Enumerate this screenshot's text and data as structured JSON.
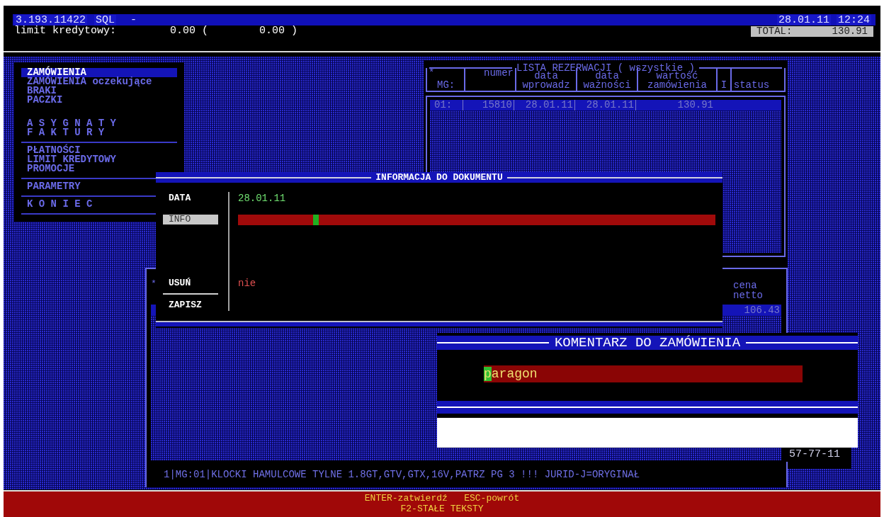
{
  "title_bar": {
    "version": "3.193.11422",
    "mode": "SQL",
    "separator": "-",
    "date": "28.01.11",
    "time": "12:24"
  },
  "credit": {
    "label": "limit kredytowy:",
    "value": "0.00 (",
    "value_2": "0.00 )"
  },
  "total": {
    "label": "TOTAL:",
    "value": "130.91"
  },
  "menu": {
    "groups": [
      {
        "divider": false,
        "items": [
          {
            "label": "ZAMÓWIENIA",
            "selected": true
          },
          {
            "label": "ZAMÓWIENIA oczekujące",
            "selected": false
          },
          {
            "label": "BRAKI",
            "selected": false
          },
          {
            "label": "PACZKI",
            "selected": false
          }
        ]
      },
      {
        "divider": true,
        "items": [
          {
            "label": "A S Y G N A T Y",
            "selected": false
          },
          {
            "label": "F A K T U R Y",
            "selected": false
          }
        ]
      },
      {
        "divider": true,
        "items": [
          {
            "label": "PŁATNOŚCI",
            "selected": false
          },
          {
            "label": "LIMIT KREDYTOWY",
            "selected": false
          },
          {
            "label": "PROMOCJE",
            "selected": false
          }
        ]
      },
      {
        "divider": true,
        "items": [
          {
            "label": "PARAMETRY",
            "selected": false
          }
        ]
      },
      {
        "divider": true,
        "items": [
          {
            "label": "K O N I E C",
            "selected": false
          }
        ]
      }
    ]
  },
  "reservations": {
    "title": "LISTA REZERWACJI ( wszystkie )",
    "columns": [
      {
        "heading": [
          "*",
          "MG:"
        ]
      },
      {
        "heading": [
          "numer"
        ]
      },
      {
        "heading": [
          "data",
          "wprowadz"
        ]
      },
      {
        "heading": [
          "data",
          "ważności"
        ]
      },
      {
        "heading": [
          "wartość",
          "zamówienia"
        ]
      },
      {
        "heading": [
          "I"
        ]
      },
      {
        "heading": [
          "status"
        ]
      }
    ],
    "rows": [
      {
        "cells": [
          "01:",
          "15810",
          "28.01.11",
          "28.01.11",
          "130.91"
        ],
        "selected": true
      }
    ]
  },
  "items_panel": {
    "marker": "*",
    "price_heading": [
      "cena",
      "netto"
    ],
    "rows": [
      {
        "price": "106.43",
        "selected": true
      }
    ],
    "code": "57-77-11",
    "description": "1|MG:01|KLOCKI HAMULCOWE TYLNE 1.8GT,GTV,GTX,16V,PATRZ PG 3 !!! JURID-J=ORYGINAŁ"
  },
  "info_dialog": {
    "title": "INFORMACJA DO DOKUMENTU",
    "fields": [
      {
        "label": "DATA",
        "kind": "date",
        "value": "28.01.11",
        "selected": false
      },
      {
        "label": "INFO",
        "kind": "input",
        "selected": true
      },
      {
        "label": "USUŃ",
        "kind": "flag",
        "value": "nie",
        "selected": false
      }
    ],
    "action": "ZAPISZ"
  },
  "comment_dialog": {
    "title": "KOMENTARZ DO ZAMÓWIENIA",
    "value": "paragon"
  },
  "footer": {
    "lines": [
      "ENTER-zatwierdź   ESC-powrót",
      "F2-STAŁE TEKSTY"
    ]
  }
}
